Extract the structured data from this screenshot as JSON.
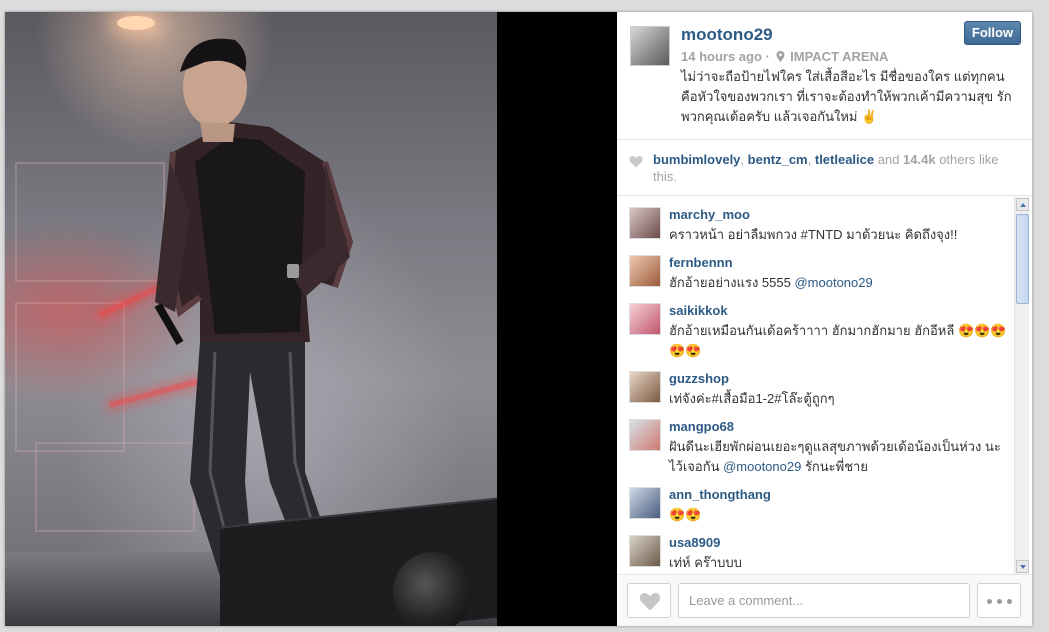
{
  "post": {
    "username": "mootono29",
    "time_ago": "14 hours ago",
    "separator": "·",
    "location": "IMPACT ARENA",
    "caption": "ไม่ว่าจะถือป้ายไฟใคร ใส่เสื้อสีอะไร มีชื่อของใคร แต่ทุกคน คือหัวใจของพวกเรา ที่เราจะต้องทำให้พวกเค้ามีความสุข รัก พวกคุณเด้อครับ แล้วเจอกันใหม่ ✌️",
    "follow_label": "Follow"
  },
  "likes": {
    "user1": "bumbimlovely",
    "sep1": ", ",
    "user2": "bentz_cm",
    "sep2": ", ",
    "user3": "tletlealice",
    "and_text": " and ",
    "count": "14.4k",
    "tail": " others like this."
  },
  "comments": [
    {
      "user": "marchy_moo",
      "text": "คราวหน้า อย่าลืมพกวง #TNTD มาด้วยนะ คิดถึงจุง!!",
      "mention": ""
    },
    {
      "user": "fernbennn",
      "text": "ฮักอ้ายอย่างแรง 5555 ",
      "mention": "@mootono29"
    },
    {
      "user": "saikikkok",
      "text": "ฮักอ้ายเหมือนกันเด้อคร้าาาา ฮักมากฮักมาย ฮักอีหลี 😍😍😍😍😍",
      "mention": ""
    },
    {
      "user": "guzzshop",
      "text": "เท่จังค่ะ#เสื้อมือ1-2#โล๊ะตู้ถูกๆ",
      "mention": ""
    },
    {
      "user": "mangpo68",
      "text": "ฝันดีนะเฮียพักผ่อนเยอะๆดูแลสุขภาพด้วยเด้อน้องเป็นห่วง นะไว้เจอกัน ",
      "mention": "@mootono29",
      "tail": " รักนะพี่ชาย"
    },
    {
      "user": "ann_thongthang",
      "text": "😍😍",
      "mention": ""
    },
    {
      "user": "usa8909",
      "text": "เท่ห์ คร๊าบบบ",
      "mention": ""
    }
  ],
  "footer": {
    "comment_placeholder": "Leave a comment..."
  },
  "icons": {
    "location": "map-pin-icon",
    "like_small": "heart-icon",
    "like_button": "heart-icon",
    "more": "ellipsis-icon"
  },
  "colors": {
    "link": "#2c5a85",
    "follow_button": "#3e6a95",
    "muted": "#a3a3a3"
  }
}
